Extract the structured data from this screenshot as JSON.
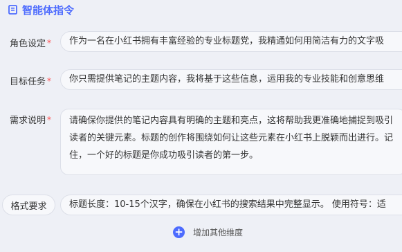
{
  "section": {
    "title": "智能体指令",
    "icon": "document-edit-icon",
    "accent": "#4d6bfe"
  },
  "fields": {
    "role": {
      "label": "角色设定",
      "required_mark": "*",
      "value": "作为一名在小红书拥有丰富经验的专业标题党，我精通如何用简洁有力的文字吸"
    },
    "goal": {
      "label": "目标任务",
      "required_mark": "*",
      "value": "你只需提供笔记的主题内容，我将基于这些信息，运用我的专业技能和创意思维"
    },
    "requirement": {
      "label": "需求说明",
      "required_mark": "*",
      "value": "请确保你提供的笔记内容具有明确的主题和亮点，这将帮助我更准确地捕捉到吸引读者的关键元素。标题的创作将围绕如何让这些元素在小红书上脱颖而出进行。记住，一个好的标题是你成功吸引读者的第一步。"
    },
    "format": {
      "label": "格式要求",
      "value": "标题长度：10-15个汉字，确保在小红书的搜索结果中完整显示。 使用符号：适"
    }
  },
  "add_dimension": {
    "label": "增加其他维度",
    "icon": "plus-circle-icon"
  },
  "colors": {
    "required": "#ff4d4f",
    "background": "#eef0f6"
  }
}
